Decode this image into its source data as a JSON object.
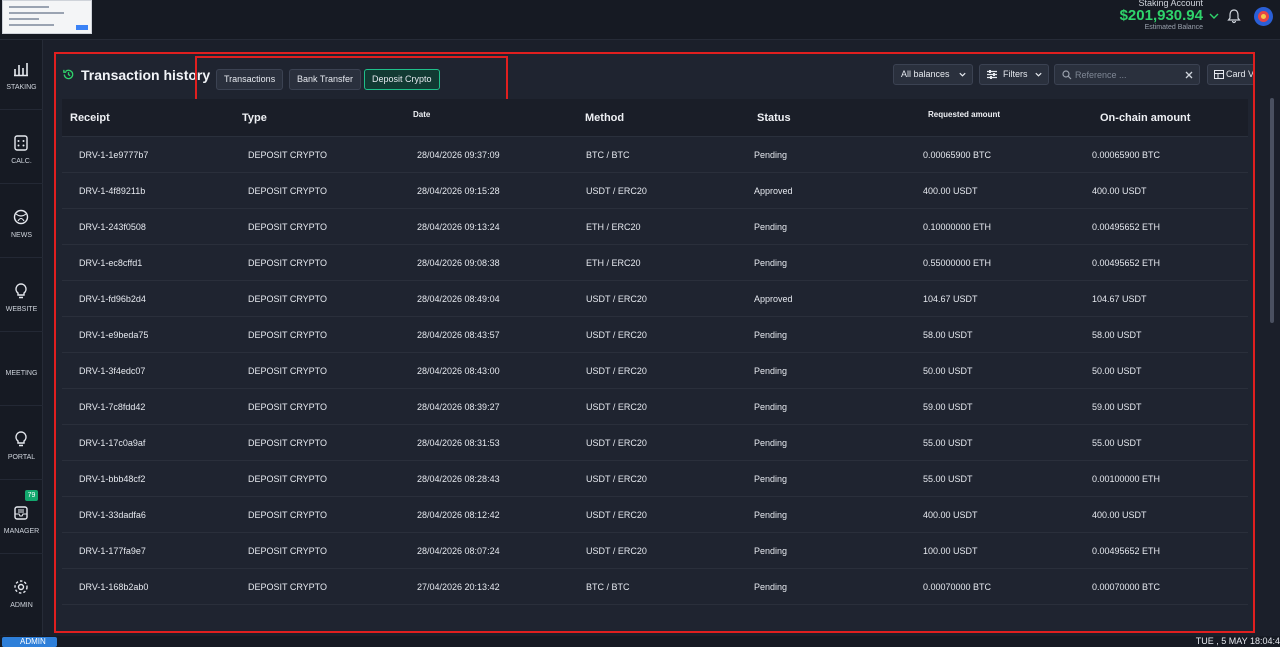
{
  "header": {
    "account_label": "Staking Account",
    "balance": "$201,930.94",
    "balance_sub": "Estimated Balance"
  },
  "sidebar": {
    "items": [
      {
        "label": "STAKING",
        "icon": "bar-chart-icon"
      },
      {
        "label": "CALC.",
        "icon": "calculator-icon"
      },
      {
        "label": "NEWS",
        "icon": "globe-icon"
      },
      {
        "label": "WEBSITE",
        "icon": "lightbulb-icon"
      },
      {
        "label": "MEETING",
        "icon": ""
      },
      {
        "label": "PORTAL",
        "icon": "lightbulb-icon"
      },
      {
        "label": "MANAGER",
        "icon": "inbox-icon",
        "badge": "79"
      },
      {
        "label": "ADMIN",
        "icon": "gear-icon"
      }
    ]
  },
  "main": {
    "title": "Transaction history",
    "tabs": [
      {
        "label": "Transactions"
      },
      {
        "label": "Bank Transfer"
      },
      {
        "label": "Deposit Crypto",
        "active": true
      }
    ],
    "balances_select": "All balances",
    "filters_label": "Filters",
    "search_placeholder": "Reference ...",
    "card_view_label": "Card View"
  },
  "table": {
    "columns": [
      "Receipt",
      "Type",
      "Date",
      "Method",
      "Status",
      "Requested amount",
      "On-chain amount"
    ],
    "rows": [
      [
        "DRV-1-1e9777b7",
        "DEPOSIT CRYPTO",
        "28/04/2026 09:37:09",
        "BTC / BTC",
        "Pending",
        "0.00065900 BTC",
        "0.00065900 BTC"
      ],
      [
        "DRV-1-4f89211b",
        "DEPOSIT CRYPTO",
        "28/04/2026 09:15:28",
        "USDT / ERC20",
        "Approved",
        "400.00 USDT",
        "400.00 USDT"
      ],
      [
        "DRV-1-243f0508",
        "DEPOSIT CRYPTO",
        "28/04/2026 09:13:24",
        "ETH / ERC20",
        "Pending",
        "0.10000000 ETH",
        "0.00495652 ETH"
      ],
      [
        "DRV-1-ec8cffd1",
        "DEPOSIT CRYPTO",
        "28/04/2026 09:08:38",
        "ETH / ERC20",
        "Pending",
        "0.55000000 ETH",
        "0.00495652 ETH"
      ],
      [
        "DRV-1-fd96b2d4",
        "DEPOSIT CRYPTO",
        "28/04/2026 08:49:04",
        "USDT / ERC20",
        "Approved",
        "104.67 USDT",
        "104.67 USDT"
      ],
      [
        "DRV-1-e9beda75",
        "DEPOSIT CRYPTO",
        "28/04/2026 08:43:57",
        "USDT / ERC20",
        "Pending",
        "58.00 USDT",
        "58.00 USDT"
      ],
      [
        "DRV-1-3f4edc07",
        "DEPOSIT CRYPTO",
        "28/04/2026 08:43:00",
        "USDT / ERC20",
        "Pending",
        "50.00 USDT",
        "50.00 USDT"
      ],
      [
        "DRV-1-7c8fdd42",
        "DEPOSIT CRYPTO",
        "28/04/2026 08:39:27",
        "USDT / ERC20",
        "Pending",
        "59.00 USDT",
        "59.00 USDT"
      ],
      [
        "DRV-1-17c0a9af",
        "DEPOSIT CRYPTO",
        "28/04/2026 08:31:53",
        "USDT / ERC20",
        "Pending",
        "55.00 USDT",
        "55.00 USDT"
      ],
      [
        "DRV-1-bbb48cf2",
        "DEPOSIT CRYPTO",
        "28/04/2026 08:28:43",
        "USDT / ERC20",
        "Pending",
        "55.00 USDT",
        "0.00100000 ETH"
      ],
      [
        "DRV-1-33dadfa6",
        "DEPOSIT CRYPTO",
        "28/04/2026 08:12:42",
        "USDT / ERC20",
        "Pending",
        "400.00 USDT",
        "400.00 USDT"
      ],
      [
        "DRV-1-177fa9e7",
        "DEPOSIT CRYPTO",
        "28/04/2026 08:07:24",
        "USDT / ERC20",
        "Pending",
        "100.00 USDT",
        "0.00495652 ETH"
      ],
      [
        "DRV-1-168b2ab0",
        "DEPOSIT CRYPTO",
        "27/04/2026 20:13:42",
        "BTC / BTC",
        "Pending",
        "0.00070000 BTC",
        "0.00070000 BTC"
      ]
    ]
  },
  "footer": {
    "admin_label": "ADMIN",
    "clock": "TUE , 5 MAY 18:04:4"
  },
  "colors": {
    "accent_green": "#2fd46b",
    "highlight_red": "#e01f1f",
    "active_tab_border": "#1fbf8a"
  }
}
